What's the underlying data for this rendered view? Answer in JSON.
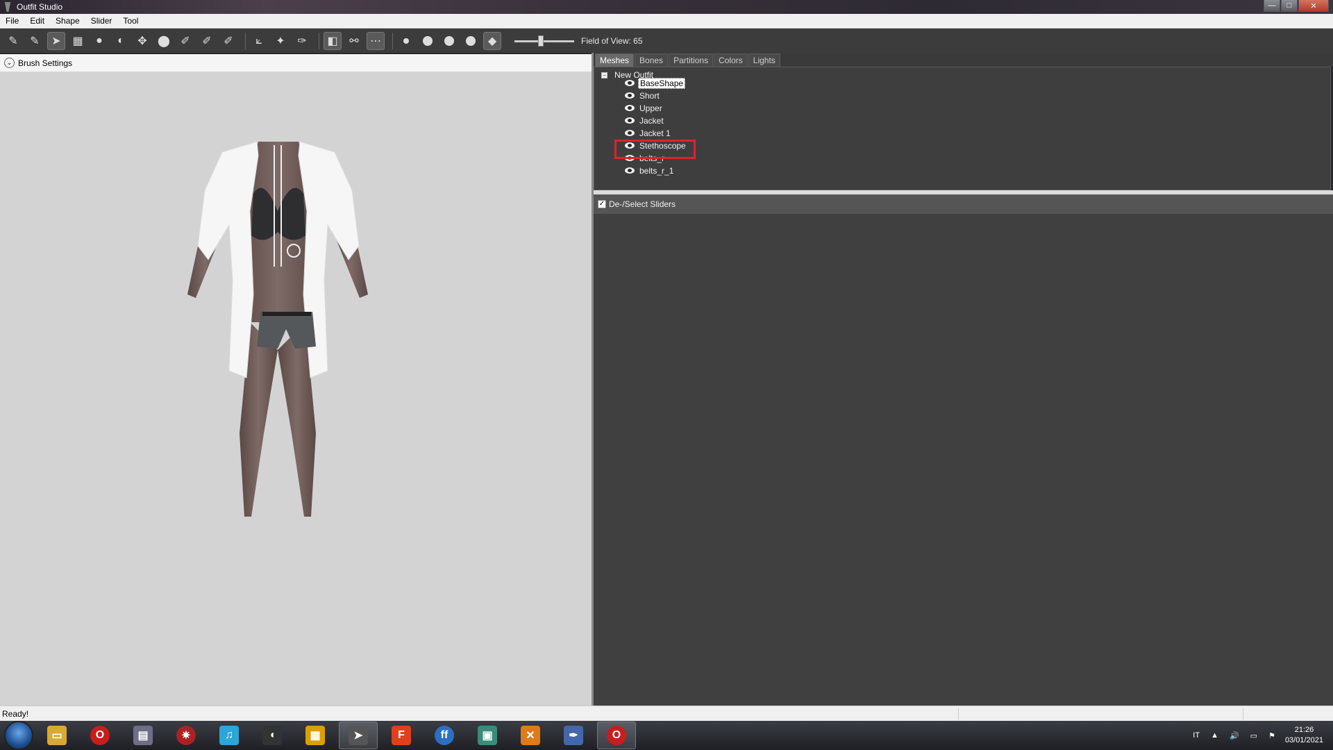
{
  "window": {
    "title": "Outfit Studio"
  },
  "menu": [
    "File",
    "Edit",
    "Shape",
    "Slider",
    "Tool"
  ],
  "toolbar": {
    "fov_label": "Field of View: 65",
    "fov_value": 65
  },
  "brush_settings": {
    "label": "Brush Settings"
  },
  "tabs": [
    "Meshes",
    "Bones",
    "Partitions",
    "Colors",
    "Lights"
  ],
  "active_tab": "Meshes",
  "tree": {
    "root": "New Outfit",
    "meshes": [
      "BaseShape",
      "Short",
      "Upper",
      "Jacket",
      "Jacket 1",
      "Stethoscope",
      "belts_r",
      "belts_r_1"
    ],
    "selected": "BaseShape",
    "highlighted": "Stethoscope"
  },
  "sliders": {
    "label": "De-/Select Sliders",
    "checked": true
  },
  "status": {
    "text": "Ready!"
  },
  "taskbar": {
    "language": "IT",
    "time": "21:26",
    "date": "03/01/2021"
  },
  "colors": {
    "highlight": "#e3202c",
    "panel": "#404040",
    "viewport": "#d3d3d3"
  }
}
